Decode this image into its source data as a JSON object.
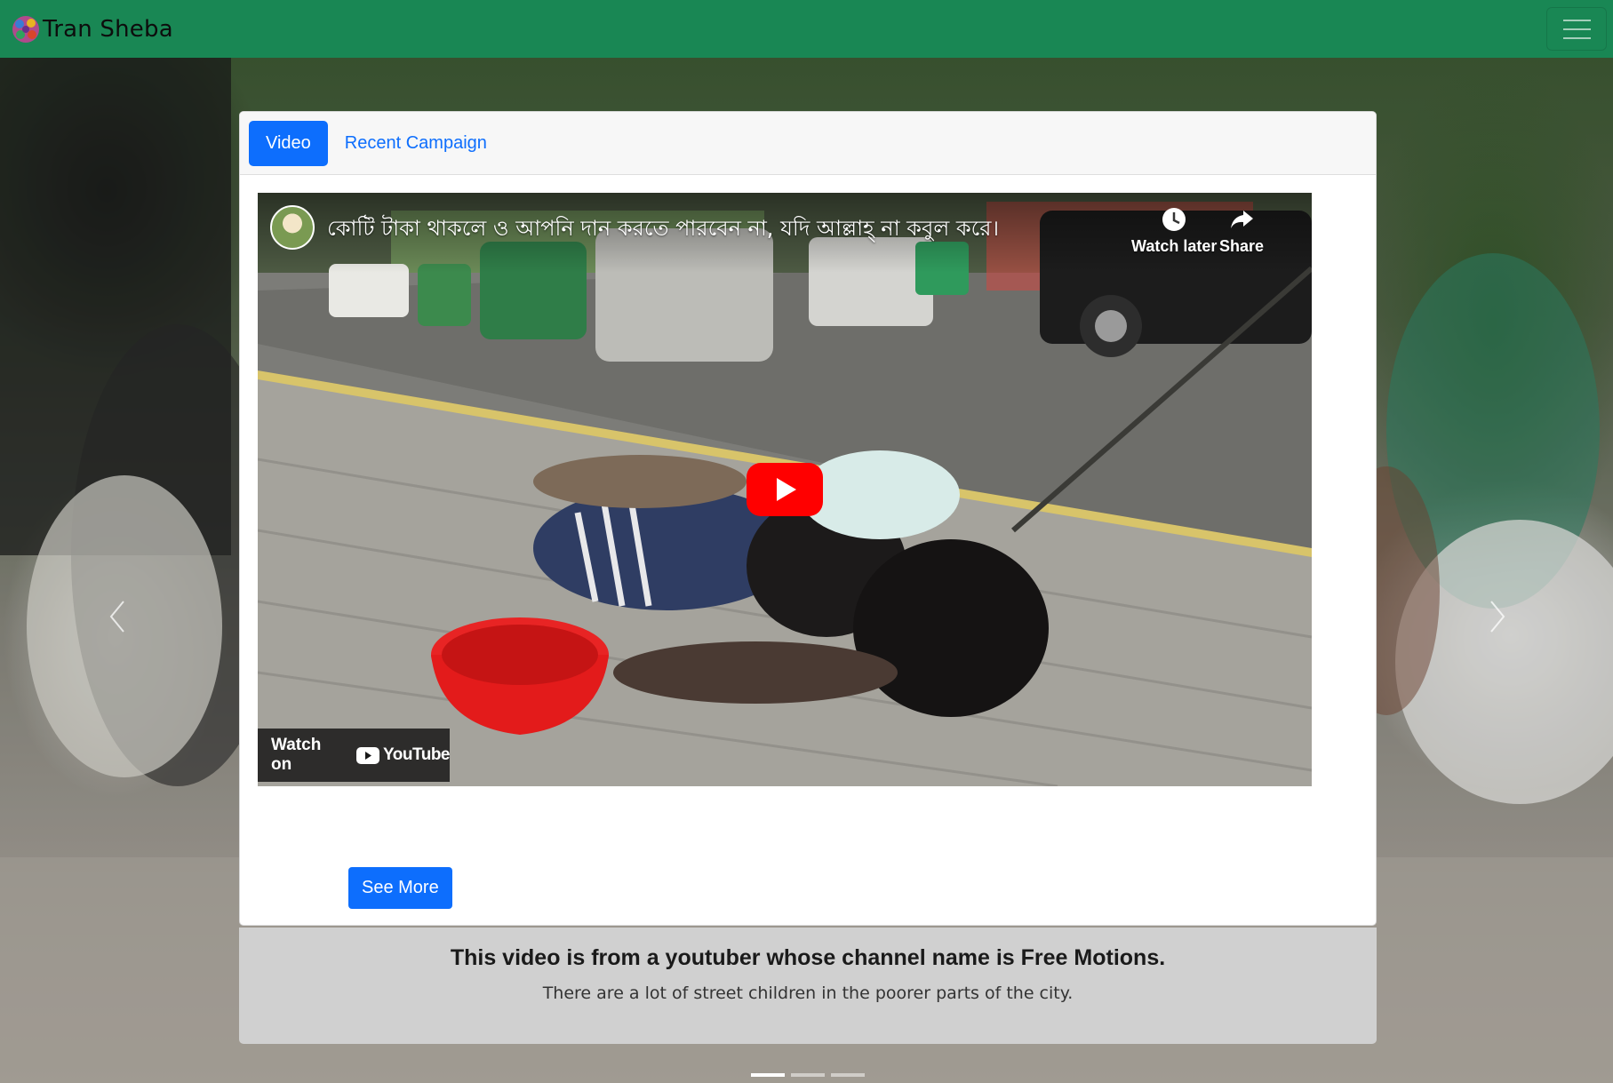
{
  "navbar": {
    "brand": "Tran Sheba",
    "color": "#198754"
  },
  "tabs": [
    {
      "label": "Video",
      "active": true
    },
    {
      "label": "Recent Campaign",
      "active": false
    }
  ],
  "video": {
    "title": "কোটি টাকা থাকলে ও আপনি দান করতে পারবেন না, যদি আল্লাহ্ না কবুল করে।",
    "watch_later": "Watch later",
    "share": "Share",
    "watch_on": "Watch on",
    "youtube": "YouTube"
  },
  "see_more": "See More",
  "caption": {
    "title_prefix": "This video is from a youtuber whose channel name is ",
    "channel": "Free Motions.",
    "text": "There are a lot of street children in the poorer parts of the city."
  },
  "carousel": {
    "slides": 3,
    "active_slide": 1
  },
  "colors": {
    "primary": "#0d6efd",
    "navbar": "#198754",
    "youtube_red": "#ff0000"
  }
}
